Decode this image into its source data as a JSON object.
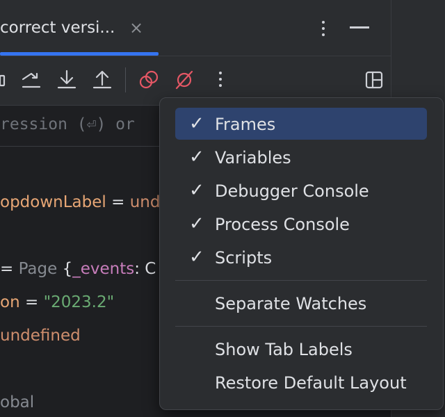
{
  "tab": {
    "title": "correct versi...",
    "close": "×"
  },
  "eval": {
    "hint": "ression (⏎) or"
  },
  "variables": {
    "line1": {
      "name": "opdownLabel",
      "eq": " = ",
      "value": "und"
    },
    "line2": {
      "prefix": "= ",
      "type": "Page",
      "brace": " {",
      "field": "_events",
      "after": ": C"
    },
    "line3": {
      "name": "on",
      "eq": " = ",
      "value": "\"2023.2\""
    },
    "line4": {
      "value": " undefined"
    },
    "line5": {
      "value": "obal"
    }
  },
  "menu": {
    "items": [
      {
        "label": "Frames",
        "checked": "✓"
      },
      {
        "label": "Variables",
        "checked": "✓"
      },
      {
        "label": "Debugger Console",
        "checked": "✓"
      },
      {
        "label": "Process Console",
        "checked": "✓"
      },
      {
        "label": "Scripts",
        "checked": "✓"
      },
      {
        "label": "Separate Watches",
        "checked": ""
      },
      {
        "label": "Show Tab Labels",
        "checked": ""
      },
      {
        "label": "Restore Default Layout",
        "checked": ""
      }
    ]
  },
  "colors": {
    "accent": "#3574f0",
    "selection": "#2e436e",
    "mute_breakpoints": "#e55765"
  },
  "icons": {
    "toolbar": [
      "step-out-partial-icon",
      "step-over-icon",
      "step-into-icon",
      "step-out-icon",
      "view-breakpoints-icon",
      "mute-breakpoints-icon",
      "more-icon",
      "layout-icon"
    ]
  }
}
